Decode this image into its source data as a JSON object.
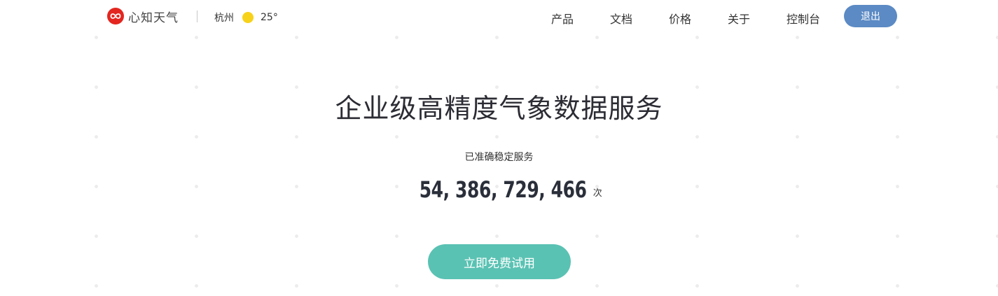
{
  "header": {
    "brand_name": "心知天气",
    "weather": {
      "city": "杭州",
      "icon": "sun-icon",
      "temperature": "25°"
    },
    "nav": {
      "products": "产品",
      "docs": "文档",
      "pricing": "价格",
      "about": "关于",
      "console": "控制台"
    },
    "logout_label": "退出"
  },
  "hero": {
    "title": "企业级高精度气象数据服务",
    "subtitle": "已准确稳定服务",
    "count": "54, 386, 729, 466",
    "count_unit": "次",
    "cta_label": "立即免费试用"
  },
  "colors": {
    "brand_red": "#e3261f",
    "logout_button": "#5b8ac4",
    "cta_button": "#5ac2b3",
    "sun": "#f7d21a"
  }
}
